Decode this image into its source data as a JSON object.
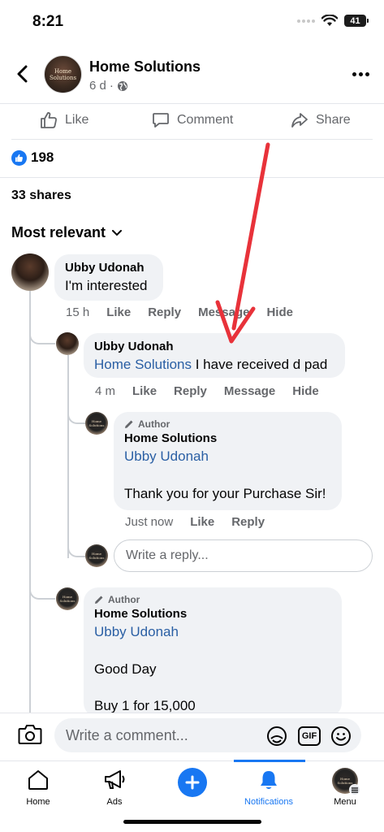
{
  "status_bar": {
    "time": "8:21",
    "battery": "41"
  },
  "header": {
    "page_name": "Home Solutions",
    "post_time": "6 d",
    "meta_sep": "·",
    "avatar_text": "Home Solutions"
  },
  "actions": {
    "like": "Like",
    "comment": "Comment",
    "share": "Share"
  },
  "reactions": {
    "count": "198"
  },
  "shares": "33 shares",
  "sort_label": "Most relevant",
  "comments": [
    {
      "name": "Ubby Udonah",
      "text": "I'm interested",
      "time": "15 h",
      "like": "Like",
      "reply": "Reply",
      "message": "Message",
      "hide": "Hide"
    },
    {
      "name": "Ubby Udonah",
      "mention": "Home Solutions",
      "text": " I have received d pad",
      "time": "4 m",
      "like": "Like",
      "reply": "Reply",
      "message": "Message",
      "hide": "Hide"
    },
    {
      "author_tag": "Author",
      "name": "Home Solutions",
      "mention": "Ubby Udonah",
      "text": "Thank you for your Purchase Sir!",
      "time": "Just now",
      "like": "Like",
      "reply": "Reply"
    },
    {
      "author_tag": "Author",
      "name": "Home Solutions",
      "mention": "Ubby Udonah",
      "text": "Good Day",
      "text2": "Buy 1 for 15,000"
    }
  ],
  "reply_placeholder": "Write a reply...",
  "comment_placeholder": "Write a comment...",
  "gif_label": "GIF",
  "tabs": [
    {
      "label": "Home",
      "icon": "home-icon"
    },
    {
      "label": "Ads",
      "icon": "megaphone-icon"
    },
    {
      "label": "",
      "icon": "plus-icon"
    },
    {
      "label": "Notifications",
      "icon": "bell-icon",
      "active": true
    },
    {
      "label": "Menu",
      "icon": "avatar"
    }
  ],
  "colors": {
    "accent": "#1877f2",
    "link": "#2a5fa4",
    "annotation_arrow": "#e8323a"
  }
}
